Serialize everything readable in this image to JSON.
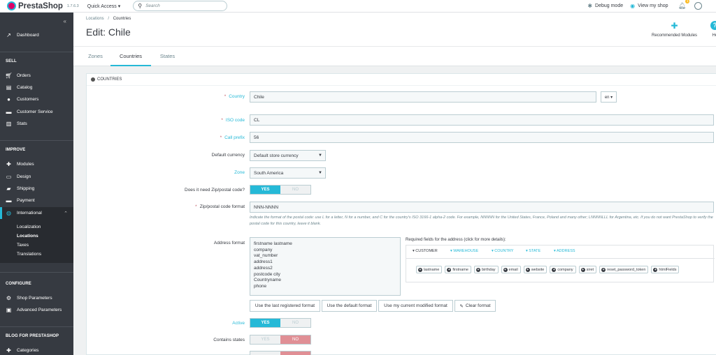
{
  "topbar": {
    "logo": "PrestaShop",
    "version": "1.7.6.3",
    "quick_access": "Quick Access ▾",
    "search_placeholder": "Search",
    "debug_mode": "Debug mode",
    "view_shop": "View my shop",
    "notifications_count": "1"
  },
  "sidebar": {
    "dashboard": "Dashboard",
    "sell_section": "SELL",
    "sell_items": [
      "Orders",
      "Catalog",
      "Customers",
      "Customer Service",
      "Stats"
    ],
    "improve_section": "IMPROVE",
    "improve_items": [
      "Modules",
      "Design",
      "Shipping",
      "Payment",
      "International"
    ],
    "international_sub": [
      "Localization",
      "Locations",
      "Taxes",
      "Translations"
    ],
    "configure_section": "CONFIGURE",
    "configure_items": [
      "Shop Parameters",
      "Advanced Parameters"
    ],
    "blog_section": "BLOG FOR PRESTASHOP",
    "blog_items": [
      "Categories"
    ]
  },
  "header": {
    "breadcrumb_parent": "Locations",
    "breadcrumb_sep": "/",
    "breadcrumb_current": "Countries",
    "title": "Edit: Chile",
    "recommended_modules": "Recommended Modules",
    "help_label": "He"
  },
  "tabs": [
    "Zones",
    "Countries",
    "States"
  ],
  "panel": {
    "heading": "COUNTRIES",
    "country_label": "Country",
    "country_value": "Chile",
    "lang_value": "en ▾",
    "iso_label": "ISO code",
    "iso_value": "CL",
    "call_prefix_label": "Call prefix",
    "call_prefix_value": "56",
    "default_currency_label": "Default currency",
    "default_currency_value": "Default store currency",
    "zone_label": "Zone",
    "zone_value": "South America",
    "zip_need_label": "Does it need Zip/postal code?",
    "yes": "YES",
    "no": "NO",
    "zip_format_label": "Zip/postal code format",
    "zip_format_value": "NNN-NNNN",
    "zip_help": "Indicate the format of the postal code: use L for a letter, N for a number, and C for the country's ISO 3166-1 alpha-2 code. For example, NNNNN for the United States, France, Poland and many other; LNNNNLLL for Argentina, etc. If you do not want PrestaShop to verify the postal code for this country, leave it blank.",
    "address_format_label": "Address format",
    "address_lines": [
      "firstname lastname",
      "company",
      "vat_number",
      "address1",
      "address2",
      "postcode city",
      "Countryname",
      "phone"
    ],
    "required_fields_title": "Required fields for the address (click for more details):",
    "required_tabs": [
      "▾ CUSTOMER",
      "▾ WAREHOUSE",
      "▾ COUNTRY",
      "▾ STATE",
      "▾ ADDRESS"
    ],
    "required_chips": [
      "lastname",
      "firstname",
      "birthday",
      "email",
      "website",
      "company",
      "siret",
      "reset_password_token",
      "htmlFields"
    ],
    "btn_last_registered": "Use the last registered format",
    "btn_default": "Use the default format",
    "btn_current_modified": "Use my current modified format",
    "btn_clear": "Clear format",
    "active_label": "Active",
    "contains_states_label": "Contains states"
  },
  "colors": {
    "accent": "#25b9d7",
    "sidebar": "#363a41",
    "danger": "#e08f95"
  }
}
